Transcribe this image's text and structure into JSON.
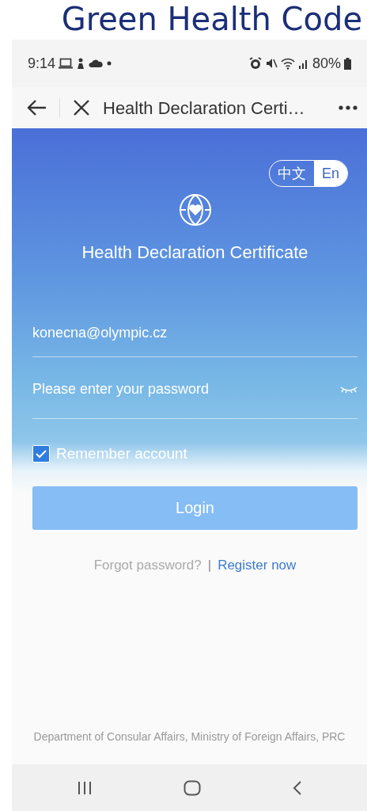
{
  "caption": "Green Health Code",
  "status_bar": {
    "time": "9:14",
    "battery": "80%"
  },
  "nav_bar": {
    "title": "Health Declaration Certi…"
  },
  "language_toggle": [
    {
      "label": "中文",
      "selected": false
    },
    {
      "label": "En",
      "selected": true
    }
  ],
  "app_title": "Health Declaration Certificate",
  "form": {
    "email": {
      "value": "konecna@olympic.cz"
    },
    "password": {
      "placeholder": "Please enter your password"
    },
    "remember": {
      "label": "Remember account",
      "checked": true
    },
    "login": "Login"
  },
  "links": [
    {
      "label": "Forgot password?",
      "kind": "muted"
    },
    {
      "label": "|",
      "kind": "separator"
    },
    {
      "label": "Register now",
      "kind": "primary"
    }
  ],
  "footer": "Department of Consular Affairs, Ministry of Foreign Affairs, PRC"
}
